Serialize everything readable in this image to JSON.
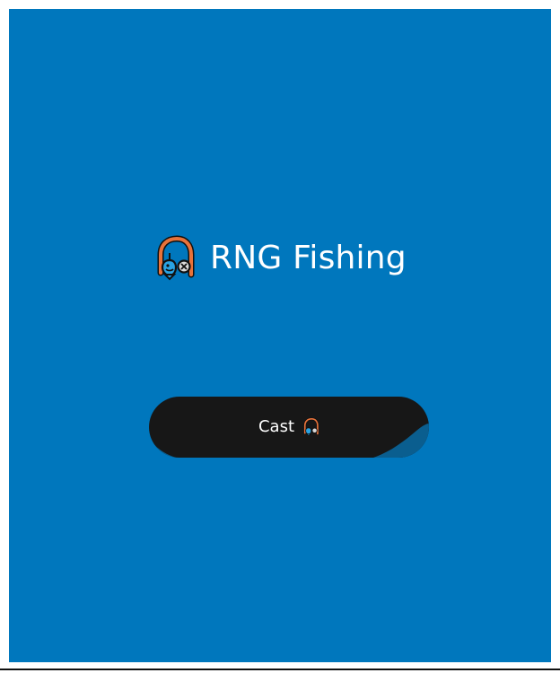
{
  "app": {
    "title": "RNG Fishing",
    "title_icon": "fishing-pole-icon"
  },
  "actions": {
    "cast_label": "Cast",
    "cast_icon": "fishing-pole-icon"
  },
  "colors": {
    "background": "#0077bd",
    "button": "#171717",
    "button_accent": "#0a5e8f",
    "text": "#ffffff",
    "icon_accent": "#e8723a",
    "fish": "#2aa4e3"
  }
}
